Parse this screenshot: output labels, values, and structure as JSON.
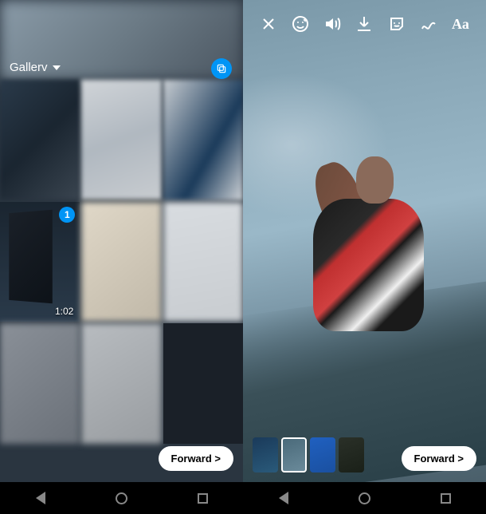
{
  "left": {
    "gallery_label": "Gallerv",
    "forward_label": "Forward >",
    "grid": {
      "selected_index_badge": "1",
      "video_duration": "1:02"
    }
  },
  "right": {
    "toolbar": {
      "close": "close",
      "effects": "effects",
      "sound": "sound",
      "download": "download",
      "sticker": "sticker",
      "draw": "draw",
      "text_label": "Aa"
    },
    "forward_label": "Forward >",
    "thumbs_count": 4,
    "selected_thumb_index": 1
  }
}
